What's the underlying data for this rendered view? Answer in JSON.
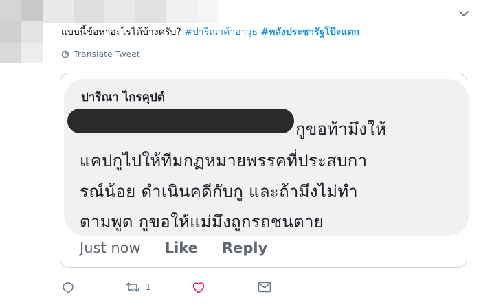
{
  "tweet": {
    "text_plain": "แบบนี้ข้อหาอะไรได้บ้างครับ?",
    "hashtag1": "#ปารีณาค้าอาวุธ",
    "hashtag2": "#พลังประชารัฐโป๊ะแตก",
    "translate_label": "Translate Tweet",
    "icon_more": "chevron-down-icon",
    "icon_translate": "globe-icon"
  },
  "facebook_comment": {
    "author": "ปารีณา ไกรคุปต์",
    "lines": [
      "กูขอท้ามึงให้",
      "แคปกูไปให้ทีมกฏหมายพรรคที่ประสบกา",
      "รณ์น้อย ดำเนินคดีกับกู และถ้ามึงไม่ทำ",
      "ตามพูด กูขอให้แม่มึงถูกรถชนตาย"
    ],
    "time": "Just now",
    "like": "Like",
    "reply": "Reply"
  },
  "actions": {
    "reply_icon": "reply-icon",
    "retweet_icon": "retweet-icon",
    "retweet_count": "1",
    "like_icon": "heart-icon",
    "dm_icon": "mail-icon"
  },
  "colors": {
    "accent": "#1b95e0",
    "like": "#e0245e",
    "muted": "#657786"
  }
}
